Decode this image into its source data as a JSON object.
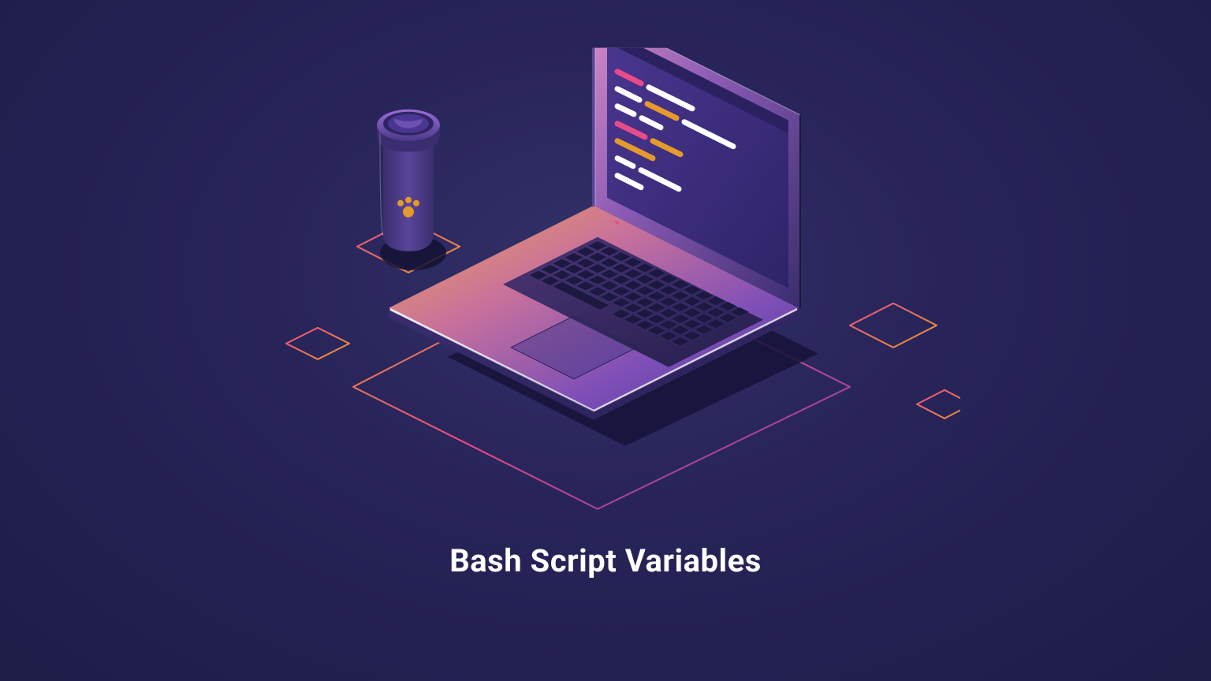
{
  "title": "Bash Script Variables",
  "colors": {
    "bg_dark": "#1e1d48",
    "bg_mid": "#282459",
    "purple": "#6b3fa0",
    "purple_light": "#9b6dd7",
    "orange": "#e59a2c",
    "pink": "#e94b8a",
    "magenta": "#d63384",
    "white": "#ffffff",
    "screen": "#3b2d7a",
    "screen_dark": "#2a2160"
  }
}
